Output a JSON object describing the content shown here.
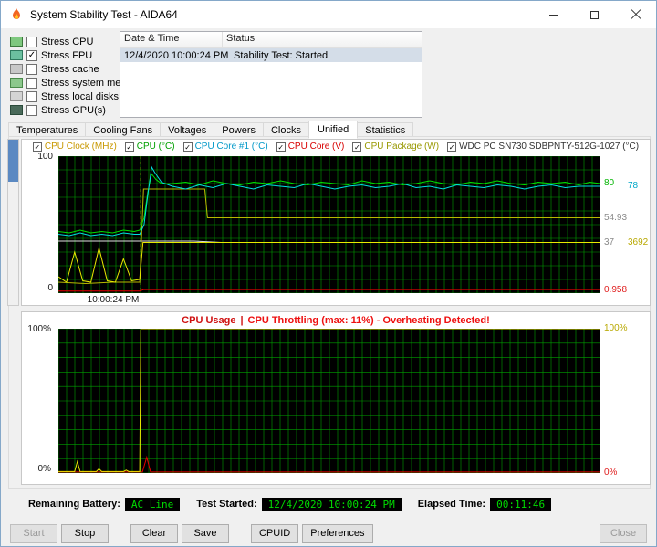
{
  "window": {
    "title": "System Stability Test - AIDA64"
  },
  "stress_options": [
    {
      "label": "Stress CPU",
      "checked": false,
      "icon": "cpu-icon",
      "icon_class": "ic-cpu"
    },
    {
      "label": "Stress FPU",
      "checked": true,
      "icon": "fpu-icon",
      "icon_class": "ic-fpu"
    },
    {
      "label": "Stress cache",
      "checked": false,
      "icon": "cache-icon",
      "icon_class": "ic-cache"
    },
    {
      "label": "Stress system memory",
      "checked": false,
      "icon": "memory-icon",
      "icon_class": "ic-memory"
    },
    {
      "label": "Stress local disks",
      "checked": false,
      "icon": "disk-icon",
      "icon_class": "ic-disk"
    },
    {
      "label": "Stress GPU(s)",
      "checked": false,
      "icon": "gpu-icon",
      "icon_class": "ic-gpu"
    }
  ],
  "log": {
    "columns": [
      "Date & Time",
      "Status"
    ],
    "rows": [
      {
        "datetime": "12/4/2020 10:00:24 PM",
        "status": "Stability Test: Started",
        "selected": true
      }
    ]
  },
  "tabs": [
    {
      "label": "Temperatures",
      "active": false
    },
    {
      "label": "Cooling Fans",
      "active": false
    },
    {
      "label": "Voltages",
      "active": false
    },
    {
      "label": "Powers",
      "active": false
    },
    {
      "label": "Clocks",
      "active": false
    },
    {
      "label": "Unified",
      "active": true
    },
    {
      "label": "Statistics",
      "active": false
    }
  ],
  "chart_data": [
    {
      "type": "line",
      "name": "unified-sensor-graph",
      "ylim": [
        0,
        100
      ],
      "y_left_top": "100",
      "y_left_bottom": "0",
      "x_tick": "10:00:24 PM",
      "marker_x": 0.152,
      "marker_color": "#e8e800",
      "bg": "#000000",
      "grid": {
        "v": 66,
        "h": 10,
        "color": "#00a000"
      },
      "legend": [
        {
          "label": "CPU Clock (MHz)",
          "label_color": "#c89800",
          "line_color": "#e8e800",
          "checked": true
        },
        {
          "label": "CPU (°C)",
          "label_color": "#00a000",
          "line_color": "#00e000",
          "checked": true
        },
        {
          "label": "CPU Core #1 (°C)",
          "label_color": "#0098c8",
          "line_color": "#00e0e0",
          "checked": true
        },
        {
          "label": "CPU Core (V)",
          "label_color": "#d80000",
          "line_color": "#e80000",
          "checked": true
        },
        {
          "label": "CPU Package (W)",
          "label_color": "#989800",
          "line_color": "#b8b800",
          "checked": true
        },
        {
          "label": "WDC PC SN730 SDBPNTY-512G-1027 (°C)",
          "label_color": "#303030",
          "line_color": "#e0e0e0",
          "checked": true
        }
      ],
      "right_labels": [
        {
          "text": "80",
          "color": "#00b400",
          "value": 80,
          "col": 0
        },
        {
          "text": "78",
          "color": "#00a8c8",
          "value": 78,
          "col": 1
        },
        {
          "text": "54.93",
          "color": "#8a8a8a",
          "value": 55,
          "col": 0
        },
        {
          "text": "37",
          "color": "#8a8a8a",
          "value": 37,
          "col": 0
        },
        {
          "text": "3692",
          "color": "#b8a800",
          "value": 37,
          "col": 1
        },
        {
          "text": "0.958",
          "color": "#e02020",
          "value": 2,
          "col": 0
        }
      ],
      "series": [
        {
          "name": "CPU Core (V)",
          "color": "#e80000",
          "points": [
            [
              0,
              1.5
            ],
            [
              0.15,
              1.5
            ],
            [
              0.157,
              2.6
            ],
            [
              0.6,
              2.6
            ],
            [
              1,
              2.6
            ]
          ]
        },
        {
          "name": "WDC PC SN730 SDBPNTY-512G-1027 (°C)",
          "color": "#e0e0e0",
          "points": [
            [
              0,
              38
            ],
            [
              0.1,
              38
            ],
            [
              0.15,
              38
            ],
            [
              0.25,
              38
            ],
            [
              0.3,
              37
            ],
            [
              0.6,
              37
            ],
            [
              1,
              37
            ]
          ]
        },
        {
          "name": "CPU Package (W)",
          "color": "#b8b800",
          "points": [
            [
              0,
              8
            ],
            [
              0.05,
              7
            ],
            [
              0.1,
              8
            ],
            [
              0.15,
              8
            ],
            [
              0.157,
              76
            ],
            [
              0.27,
              76
            ],
            [
              0.275,
              55
            ],
            [
              0.6,
              55
            ],
            [
              1,
              55
            ]
          ]
        },
        {
          "name": "CPU Clock (MHz)",
          "color": "#e8e800",
          "points": [
            [
              0,
              12
            ],
            [
              0.015,
              8
            ],
            [
              0.03,
              30
            ],
            [
              0.045,
              9
            ],
            [
              0.06,
              8
            ],
            [
              0.075,
              33
            ],
            [
              0.09,
              9
            ],
            [
              0.105,
              8
            ],
            [
              0.12,
              25
            ],
            [
              0.135,
              9
            ],
            [
              0.15,
              10
            ],
            [
              0.156,
              37
            ],
            [
              0.3,
              37
            ],
            [
              0.5,
              37
            ],
            [
              0.7,
              37
            ],
            [
              0.9,
              37
            ],
            [
              1,
              37
            ]
          ]
        },
        {
          "name": "CPU (°C)",
          "color": "#00e000",
          "points": [
            [
              0,
              45
            ],
            [
              0.02,
              44
            ],
            [
              0.04,
              46
            ],
            [
              0.06,
              44
            ],
            [
              0.08,
              45
            ],
            [
              0.1,
              44
            ],
            [
              0.12,
              46
            ],
            [
              0.14,
              45
            ],
            [
              0.15,
              46
            ],
            [
              0.158,
              55
            ],
            [
              0.165,
              74
            ],
            [
              0.172,
              87
            ],
            [
              0.18,
              83
            ],
            [
              0.19,
              80
            ],
            [
              0.21,
              80
            ],
            [
              0.235,
              81
            ],
            [
              0.26,
              79
            ],
            [
              0.285,
              82
            ],
            [
              0.31,
              80
            ],
            [
              0.335,
              79
            ],
            [
              0.36,
              81
            ],
            [
              0.385,
              80
            ],
            [
              0.41,
              82
            ],
            [
              0.435,
              80
            ],
            [
              0.46,
              79
            ],
            [
              0.485,
              81
            ],
            [
              0.51,
              80
            ],
            [
              0.535,
              79
            ],
            [
              0.56,
              82
            ],
            [
              0.585,
              80
            ],
            [
              0.61,
              81
            ],
            [
              0.635,
              79
            ],
            [
              0.66,
              80
            ],
            [
              0.685,
              82
            ],
            [
              0.71,
              80
            ],
            [
              0.735,
              79
            ],
            [
              0.76,
              81
            ],
            [
              0.785,
              80
            ],
            [
              0.81,
              82
            ],
            [
              0.835,
              80
            ],
            [
              0.86,
              79
            ],
            [
              0.885,
              81
            ],
            [
              0.91,
              80
            ],
            [
              0.935,
              81
            ],
            [
              0.96,
              79
            ],
            [
              0.98,
              81
            ],
            [
              1,
              80
            ]
          ]
        },
        {
          "name": "CPU Core #1 (°C)",
          "color": "#00e0e0",
          "points": [
            [
              0,
              43
            ],
            [
              0.02,
              42
            ],
            [
              0.04,
              44
            ],
            [
              0.06,
              42
            ],
            [
              0.08,
              43
            ],
            [
              0.1,
              42
            ],
            [
              0.12,
              44
            ],
            [
              0.14,
              43
            ],
            [
              0.15,
              43
            ],
            [
              0.158,
              50
            ],
            [
              0.165,
              72
            ],
            [
              0.172,
              92
            ],
            [
              0.178,
              88
            ],
            [
              0.19,
              81
            ],
            [
              0.21,
              78
            ],
            [
              0.235,
              76
            ],
            [
              0.26,
              79
            ],
            [
              0.285,
              77
            ],
            [
              0.31,
              80
            ],
            [
              0.335,
              78
            ],
            [
              0.36,
              76
            ],
            [
              0.385,
              79
            ],
            [
              0.41,
              78
            ],
            [
              0.435,
              77
            ],
            [
              0.46,
              80
            ],
            [
              0.485,
              78
            ],
            [
              0.51,
              76
            ],
            [
              0.535,
              78
            ],
            [
              0.56,
              79
            ],
            [
              0.585,
              77
            ],
            [
              0.61,
              78
            ],
            [
              0.635,
              80
            ],
            [
              0.66,
              77
            ],
            [
              0.685,
              78
            ],
            [
              0.71,
              76
            ],
            [
              0.735,
              79
            ],
            [
              0.76,
              78
            ],
            [
              0.785,
              77
            ],
            [
              0.81,
              79
            ],
            [
              0.835,
              78
            ],
            [
              0.86,
              76
            ],
            [
              0.885,
              78
            ],
            [
              0.91,
              79
            ],
            [
              0.935,
              77
            ],
            [
              0.96,
              78
            ],
            [
              1,
              78
            ]
          ]
        }
      ]
    },
    {
      "type": "line",
      "name": "cpu-usage-graph",
      "title_main": "CPU Usage",
      "title_sep": "|",
      "title_warning": "CPU Throttling (max: 11%) - Overheating Detected!",
      "title_main_color": "#cf1010",
      "title_warning_color": "#ee1010",
      "ylim": [
        0,
        100
      ],
      "left_top": "100%",
      "left_bottom": "0%",
      "bg": "#000000",
      "grid": {
        "v": 66,
        "h": 10,
        "color": "#00a000"
      },
      "right_labels": [
        {
          "text": "100%",
          "color": "#b8a800",
          "value": 100,
          "col": 0
        },
        {
          "text": "0%",
          "color": "#e02020",
          "value": 0,
          "col": 0
        }
      ],
      "series": [
        {
          "name": "CPU Throttling",
          "color": "#e80000",
          "points": [
            [
              0,
              0.7
            ],
            [
              0.155,
              0.7
            ],
            [
              0.163,
              11
            ],
            [
              0.17,
              0.7
            ],
            [
              0.6,
              0.7
            ],
            [
              1,
              0.7
            ]
          ]
        },
        {
          "name": "CPU Usage",
          "color": "#e8e800",
          "points": [
            [
              0,
              1
            ],
            [
              0.03,
              1
            ],
            [
              0.035,
              8
            ],
            [
              0.04,
              1
            ],
            [
              0.07,
              1
            ],
            [
              0.075,
              3
            ],
            [
              0.08,
              1
            ],
            [
              0.12,
              1
            ],
            [
              0.125,
              2
            ],
            [
              0.13,
              1
            ],
            [
              0.15,
              1
            ],
            [
              0.152,
              100
            ],
            [
              0.4,
              100
            ],
            [
              0.7,
              100
            ],
            [
              1,
              100
            ]
          ]
        }
      ]
    }
  ],
  "status_bar": {
    "battery_label": "Remaining Battery:",
    "battery_value": "AC Line",
    "started_label": "Test Started:",
    "started_value": "12/4/2020 10:00:24 PM",
    "elapsed_label": "Elapsed Time:",
    "elapsed_value": "00:11:46",
    "value_color": "#00dc00",
    "value_bg": "#000000"
  },
  "action_buttons": [
    {
      "label": "Start",
      "enabled": false
    },
    {
      "label": "Stop",
      "enabled": true
    },
    {
      "label": "Clear",
      "enabled": true,
      "gap_before": true
    },
    {
      "label": "Save",
      "enabled": true
    },
    {
      "label": "CPUID",
      "enabled": true,
      "gap_before": true
    },
    {
      "label": "Preferences",
      "enabled": true
    },
    {
      "label": "Close",
      "enabled": false,
      "align": "right"
    }
  ]
}
